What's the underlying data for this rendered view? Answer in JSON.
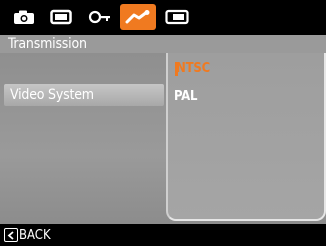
{
  "tabs": [
    {
      "icon": "camera-icon",
      "active": false
    },
    {
      "icon": "video-frame-icon",
      "active": false
    },
    {
      "icon": "key-icon",
      "active": false
    },
    {
      "icon": "wrench-icon",
      "active": true
    },
    {
      "icon": "playback-icon",
      "active": false
    }
  ],
  "section": {
    "title": "Transmission"
  },
  "menu": {
    "selected_item": "Video System"
  },
  "options": {
    "items": [
      "NTSC",
      "PAL"
    ],
    "selected": "NTSC"
  },
  "footer": {
    "back_label": "BACK"
  },
  "colors": {
    "accent": "#f07a20"
  }
}
